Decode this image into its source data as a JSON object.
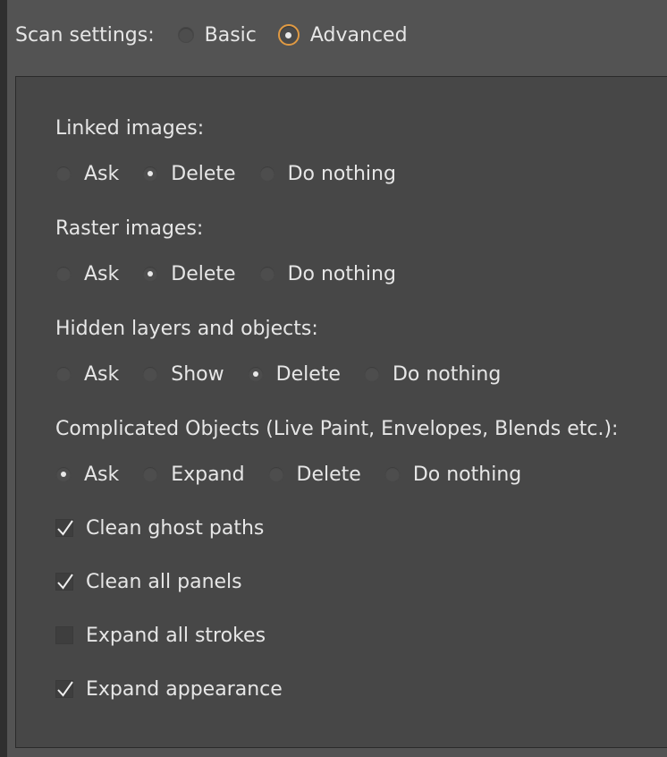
{
  "scan_settings": {
    "label": "Scan settings:",
    "options": [
      {
        "label": "Basic",
        "selected": false
      },
      {
        "label": "Advanced",
        "selected": true
      }
    ]
  },
  "sections": [
    {
      "label": "Linked images:",
      "options": [
        {
          "label": "Ask",
          "selected": false
        },
        {
          "label": "Delete",
          "selected": true
        },
        {
          "label": "Do nothing",
          "selected": false
        }
      ]
    },
    {
      "label": "Raster images:",
      "options": [
        {
          "label": "Ask",
          "selected": false
        },
        {
          "label": "Delete",
          "selected": true
        },
        {
          "label": "Do nothing",
          "selected": false
        }
      ]
    },
    {
      "label": "Hidden layers and objects:",
      "options": [
        {
          "label": "Ask",
          "selected": false
        },
        {
          "label": "Show",
          "selected": false
        },
        {
          "label": "Delete",
          "selected": true
        },
        {
          "label": "Do nothing",
          "selected": false
        }
      ]
    },
    {
      "label": "Complicated Objects  (Live Paint, Envelopes, Blends etc.):",
      "options": [
        {
          "label": "Ask",
          "selected": true
        },
        {
          "label": "Expand",
          "selected": false
        },
        {
          "label": "Delete",
          "selected": false
        },
        {
          "label": "Do nothing",
          "selected": false
        }
      ]
    }
  ],
  "checkboxes": [
    {
      "label": "Clean ghost paths",
      "checked": true
    },
    {
      "label": "Clean all panels",
      "checked": true
    },
    {
      "label": "Expand all strokes",
      "checked": false
    },
    {
      "label": "Expand appearance",
      "checked": true
    }
  ],
  "colors": {
    "background": "#535353",
    "panel": "#474747",
    "text": "#e6e6e6",
    "focus_ring": "#e09a43"
  },
  "icons": {
    "radio": "radio-button-icon",
    "checkbox": "checkbox-icon",
    "checkmark": "checkmark-icon"
  }
}
